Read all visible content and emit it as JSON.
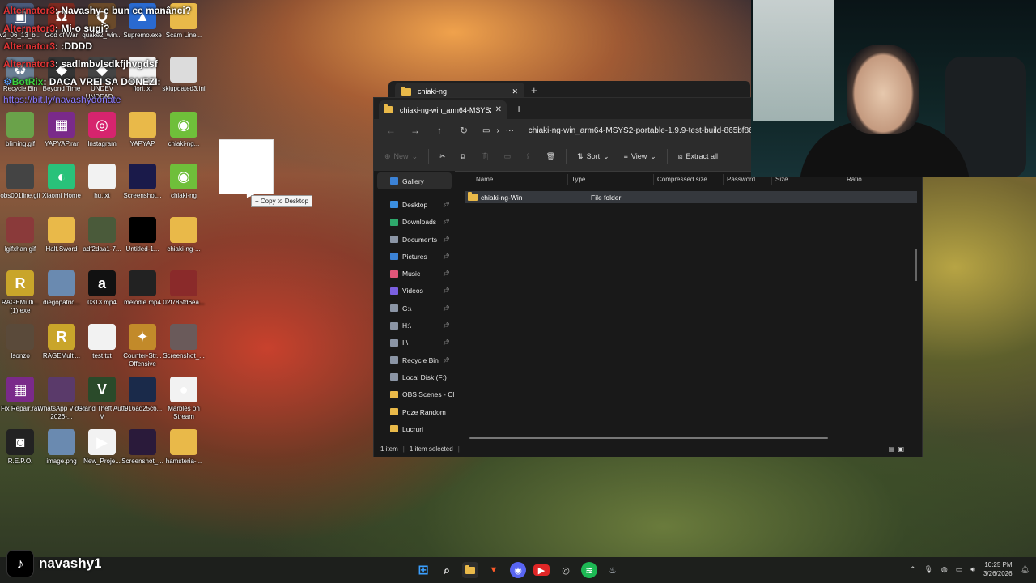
{
  "chat": [
    {
      "user": "Alternator3",
      "user_display": "Alternator3",
      "message": ": Navashy e bun ce manânci?"
    },
    {
      "user": "Alternator3",
      "message": ": Mi-o sugi?"
    },
    {
      "user": "Alternator3",
      "message": ": :DDDD"
    },
    {
      "user": "Alternator3",
      "message": ": sadlmbvlsdkfjhvgdsf"
    },
    {
      "user": "BotRix",
      "message": ": DACA VREI SA DONEZI:",
      "bot": true
    },
    {
      "link": "https://bit.ly/navashydonate"
    }
  ],
  "desktop": {
    "icons": [
      {
        "label": "v2_06_13_b...",
        "color": "#4a5a7a",
        "glyph": "▣"
      },
      {
        "label": "God of War",
        "color": "#7a2a20",
        "glyph": "Ω"
      },
      {
        "label": "quake2_win...",
        "color": "#6a4a2a",
        "glyph": "Q"
      },
      {
        "label": "Supremo.exe",
        "color": "#2a6ad0",
        "glyph": "▲"
      },
      {
        "label": "Scam Line...",
        "color": "#e9b949",
        "glyph": ""
      },
      {
        "label": "Recycle Bin",
        "color": "#6a7f94",
        "glyph": "♻"
      },
      {
        "label": "Beyond Time",
        "color": "#333",
        "glyph": "◆"
      },
      {
        "label": "UNDEV UNDEAD...",
        "color": "#444",
        "glyph": "◆"
      },
      {
        "label": "flori.txt",
        "color": "#f2f2f2",
        "glyph": ""
      },
      {
        "label": "skiupdated3.ini",
        "color": "#dcdcdc",
        "glyph": ""
      },
      {
        "label": "bliming.gif",
        "color": "#6aa24a",
        "glyph": ""
      },
      {
        "label": "YAPYAP.rar",
        "color": "#7a2a8a",
        "glyph": "▦"
      },
      {
        "label": "Instagram",
        "color": "#d6246e",
        "glyph": "◎"
      },
      {
        "label": "YAPYAP",
        "color": "#e9b949",
        "glyph": ""
      },
      {
        "label": "chiaki-ng...",
        "color": "#6fbf3a",
        "glyph": "◉"
      },
      {
        "label": "obs001line.gif",
        "color": "#444",
        "glyph": ""
      },
      {
        "label": "Xiaomi Home",
        "color": "#29c27a",
        "glyph": "◐"
      },
      {
        "label": "hu.txt",
        "color": "#f2f2f2",
        "glyph": ""
      },
      {
        "label": "Screenshot...",
        "color": "#1a1a4a",
        "glyph": ""
      },
      {
        "label": "chiaki-ng",
        "color": "#6fbf3a",
        "glyph": "◉"
      },
      {
        "label": "lgifxhan.gif",
        "color": "#8a3a3a",
        "glyph": ""
      },
      {
        "label": "Half.Sword",
        "color": "#e9b949",
        "glyph": ""
      },
      {
        "label": "adf2daa1-7...",
        "color": "#4a5a3a",
        "glyph": ""
      },
      {
        "label": "Untitled-1...",
        "color": "#000",
        "glyph": ""
      },
      {
        "label": "chiaki-ng-...",
        "color": "#e9b949",
        "glyph": ""
      },
      {
        "label": "RAGEMulti... (1).exe",
        "color": "#c9a52a",
        "glyph": "R"
      },
      {
        "label": "diegopatric...",
        "color": "#6a8ab0",
        "glyph": ""
      },
      {
        "label": "0313.mp4",
        "color": "#111",
        "glyph": "a"
      },
      {
        "label": "melodie.mp4",
        "color": "#222",
        "glyph": ""
      },
      {
        "label": "02f785fd6ea...",
        "color": "#8a2a2a",
        "glyph": ""
      },
      {
        "label": "Isonzo",
        "color": "#5a4a3a",
        "glyph": ""
      },
      {
        "label": "RAGEMulti...",
        "color": "#c9a52a",
        "glyph": "R"
      },
      {
        "label": "test.txt",
        "color": "#f2f2f2",
        "glyph": ""
      },
      {
        "label": "Counter-Str... Offensive",
        "color": "#c28a2a",
        "glyph": "✦"
      },
      {
        "label": "Screenshot_...",
        "color": "#6a5a5a",
        "glyph": ""
      },
      {
        "label": "Fix Repair.rar",
        "color": "#7a2a8a",
        "glyph": "▦"
      },
      {
        "label": "WhatsApp Video 2026-...",
        "color": "#5a3a6a",
        "glyph": ""
      },
      {
        "label": "Grand Theft Auto V",
        "color": "#2a4a2a",
        "glyph": "V"
      },
      {
        "label": "f916ad25c6...",
        "color": "#1a2a4a",
        "glyph": ""
      },
      {
        "label": "Marbles on Stream",
        "color": "#f2f2f2",
        "glyph": "●"
      },
      {
        "label": "R.E.P.O.",
        "color": "#222",
        "glyph": "◙"
      },
      {
        "label": "image.png",
        "color": "#6a8ab0",
        "glyph": ""
      },
      {
        "label": "New_Proje...",
        "color": "#f2f2f2",
        "glyph": "▶"
      },
      {
        "label": "Screenshot_...",
        "color": "#2a1a3a",
        "glyph": ""
      },
      {
        "label": "hamsteria-...",
        "color": "#e9b949",
        "glyph": ""
      }
    ]
  },
  "drag": {
    "tooltip": "+ Copy to Desktop"
  },
  "back_window": {
    "tab": "chiaki-ng",
    "close": "✕",
    "plus": "+"
  },
  "explorer": {
    "tab_title": "chiaki-ng-win_arm64-MSYS2-p",
    "tab_close": "✕",
    "new_tab": "+",
    "address": "chiaki-ng-win_arm64-MSYS2-portable-1.9.9-test-build-865bf86e",
    "toolbar": {
      "new": "New",
      "sort": "Sort",
      "view": "View",
      "extract": "Extract all"
    },
    "sidebar": [
      {
        "label": "Gallery",
        "color": "#3b82d6",
        "pin": false,
        "selected": true
      },
      {
        "label": "Desktop",
        "color": "#3b8fe0",
        "pin": true
      },
      {
        "label": "Downloads",
        "color": "#2ea86b",
        "pin": true
      },
      {
        "label": "Documents",
        "color": "#8b95a5",
        "pin": true
      },
      {
        "label": "Pictures",
        "color": "#3b82d6",
        "pin": true
      },
      {
        "label": "Music",
        "color": "#e0567a",
        "pin": true
      },
      {
        "label": "Videos",
        "color": "#7a5fe0",
        "pin": true
      },
      {
        "label": "G:\\",
        "color": "#8b95a5",
        "pin": true
      },
      {
        "label": "H:\\",
        "color": "#8b95a5",
        "pin": true
      },
      {
        "label": "I:\\",
        "color": "#8b95a5",
        "pin": true
      },
      {
        "label": "Recycle Bin",
        "color": "#8b95a5",
        "pin": true
      },
      {
        "label": "Local Disk (F:)",
        "color": "#8b95a5",
        "pin": false
      },
      {
        "label": "OBS Scenes - Cl",
        "color": "#e9b949",
        "pin": false
      },
      {
        "label": "Poze Random",
        "color": "#e9b949",
        "pin": false
      },
      {
        "label": "Lucruri",
        "color": "#e9b949",
        "pin": false
      }
    ],
    "columns": [
      "Name",
      "Type",
      "Compressed size",
      "Password ...",
      "Size",
      "Ratio"
    ],
    "rows": [
      {
        "name": "chiaki-ng-Win",
        "type": "File folder"
      }
    ],
    "status": {
      "count": "1 item",
      "selected": "1 item selected"
    }
  },
  "taskbar": {
    "tiktok_handle": "navashy1",
    "time": "10:25 PM",
    "date": "3/26/2026",
    "apps": [
      "start",
      "search",
      "explorer",
      "brave",
      "discord",
      "youtube",
      "chrome",
      "spotify",
      "steam"
    ]
  }
}
